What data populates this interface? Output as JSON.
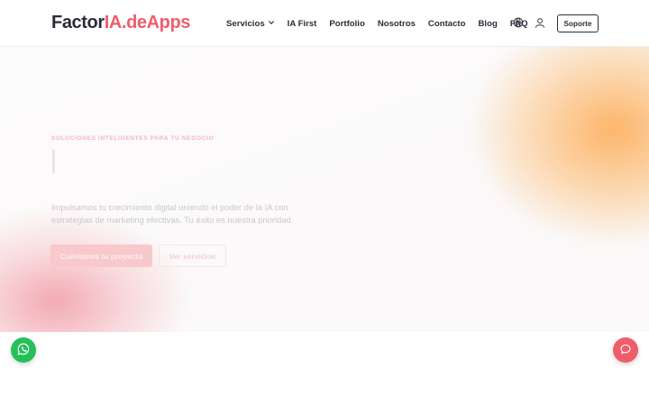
{
  "header": {
    "logo_part1": "Factor",
    "logo_part2": "IA.deApps",
    "nav": {
      "servicios": "Servicios",
      "ia_first": "IA First",
      "portfolio": "Portfolio",
      "nosotros": "Nosotros",
      "contacto": "Contacto",
      "blog": "Blog",
      "faq": "FAQ"
    },
    "icons": {
      "language": "globe-icon",
      "account": "user-icon",
      "dropdown": "chevron-down-icon"
    },
    "support_label": "Soporte"
  },
  "hero": {
    "eyebrow": "SOLUCIONES INTELIGENTES PARA TU NEGOCIO",
    "description": "Impulsamos tu crecimiento digital uniendo el poder de la IA con estrategias de marketing efectivas. Tu éxito es nuestra prioridad.",
    "cta_primary": "Cuéntanos tu proyecto",
    "cta_secondary": "Ver servicios"
  },
  "floating": {
    "whatsapp_icon": "whatsapp-icon",
    "chat_icon": "chat-bubble-icon"
  },
  "colors": {
    "brand_accent": "#ef5d6b",
    "logo_dark": "#2a2d36",
    "whatsapp_green": "#25c05a",
    "orange_glow": "#fcb060",
    "pink_glow": "#f096a0"
  }
}
